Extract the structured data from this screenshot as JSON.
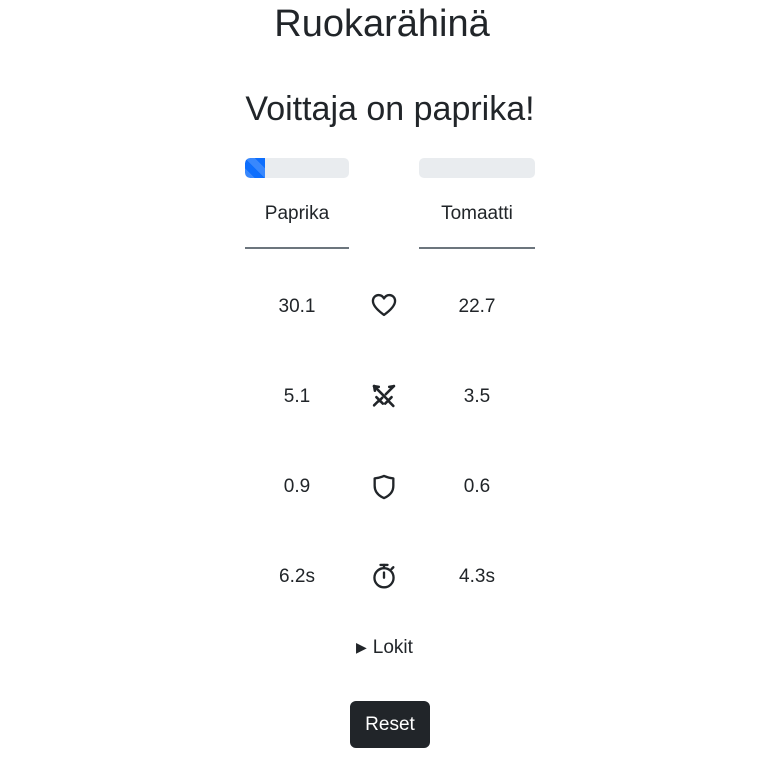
{
  "title": "Ruokarähinä",
  "winner_text": "Voittaja on paprika!",
  "fighters": [
    {
      "name": "Paprika",
      "health_fraction": 0.19
    },
    {
      "name": "Tomaatti",
      "health_fraction": 0.0
    }
  ],
  "accent_color": "#0d6efd",
  "stats": [
    {
      "icon": "heart-icon",
      "left": "30.1",
      "right": "22.7"
    },
    {
      "icon": "crossed-swords-icon",
      "left": "5.1",
      "right": "3.5"
    },
    {
      "icon": "shield-icon",
      "left": "0.9",
      "right": "0.6"
    },
    {
      "icon": "stopwatch-icon",
      "left": "6.2s",
      "right": "4.3s"
    }
  ],
  "logs": {
    "label": "Lokit",
    "expanded": false
  },
  "reset_label": "Reset"
}
